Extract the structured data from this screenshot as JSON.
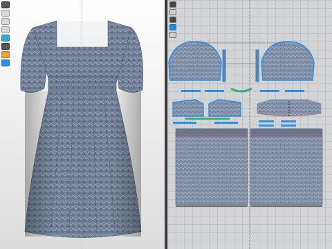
{
  "colors": {
    "fabric": "#6d7c94",
    "fabric_dark": "#4c5a72",
    "seam_blue": "#2f8fe8",
    "seam_green": "#35b07a",
    "seam_red": "#e06b6b",
    "grid_bg": "#d3d4d6",
    "view3d_bg": "#efefef"
  },
  "view3d": {
    "toolbar": [
      {
        "icon": "select-icon"
      },
      {
        "icon": "hanger-icon"
      },
      {
        "icon": "avatar-icon"
      },
      {
        "icon": "camera-icon"
      },
      {
        "icon": "fabric-icon"
      },
      {
        "icon": "pin-icon"
      },
      {
        "icon": "texture-icon"
      },
      {
        "icon": "measure-icon"
      }
    ]
  },
  "view2d": {
    "toolbar": [
      {
        "icon": "edit-pattern-icon"
      },
      {
        "icon": "transform-icon"
      },
      {
        "icon": "segment-icon"
      },
      {
        "icon": "fill-icon"
      },
      {
        "icon": "grain-icon"
      }
    ]
  }
}
